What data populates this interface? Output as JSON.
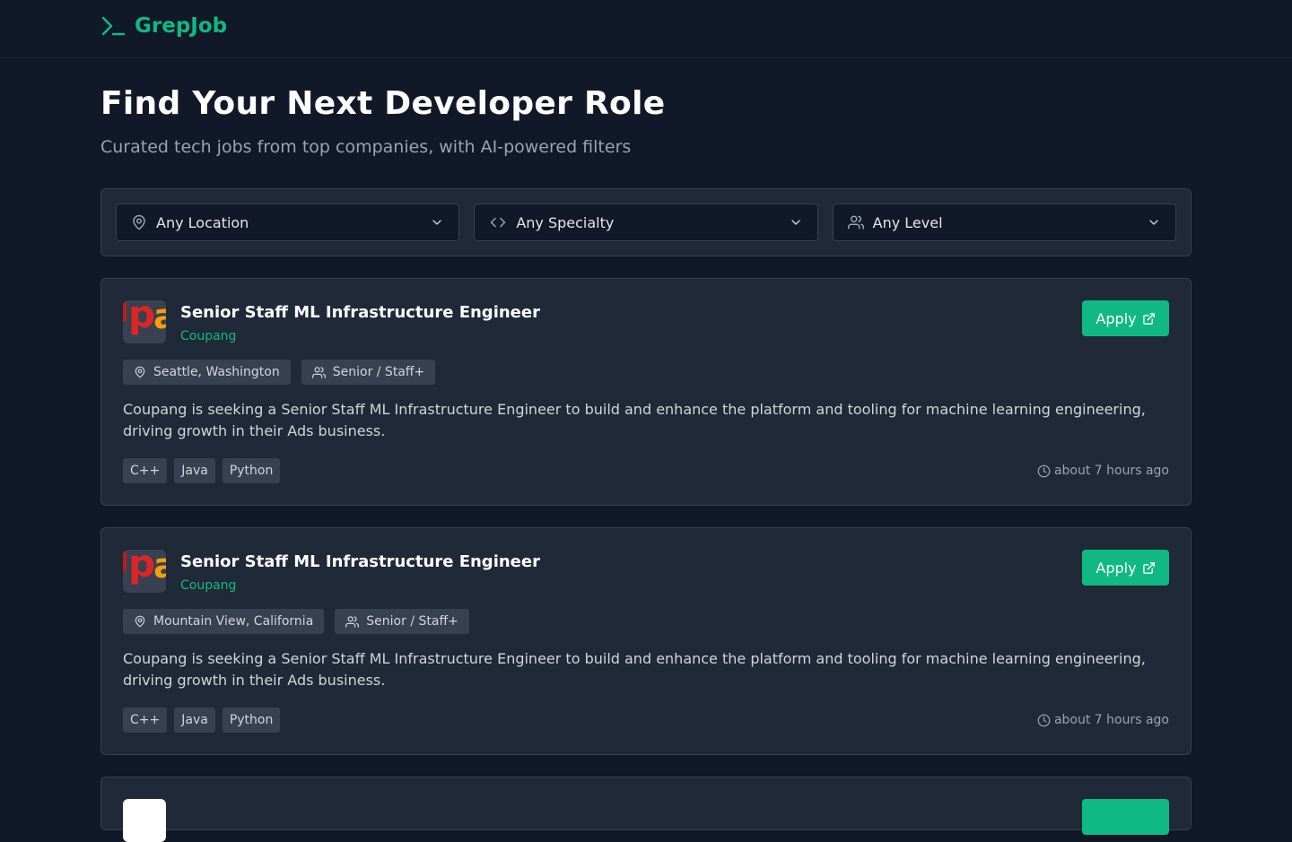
{
  "brand": {
    "name": "GrepJob",
    "accent": "#10b981"
  },
  "hero": {
    "title": "Find Your Next Developer Role",
    "subtitle": "Curated tech jobs from top companies, with AI-powered filters"
  },
  "filters": {
    "location": "Any Location",
    "specialty": "Any Specialty",
    "level": "Any Level"
  },
  "jobs": [
    {
      "title": "Senior Staff ML Infrastructure Engineer",
      "company": "Coupang",
      "location": "Seattle, Washington",
      "level": "Senior / Staff+",
      "description": "Coupang is seeking a Senior Staff ML Infrastructure Engineer to build and enhance the platform and tooling for machine learning engineering, driving growth in their Ads business.",
      "tags": [
        "C++",
        "Java",
        "Python"
      ],
      "posted": "about 7 hours ago",
      "apply_label": "Apply"
    },
    {
      "title": "Senior Staff ML Infrastructure Engineer",
      "company": "Coupang",
      "location": "Mountain View, California",
      "level": "Senior / Staff+",
      "description": "Coupang is seeking a Senior Staff ML Infrastructure Engineer to build and enhance the platform and tooling for machine learning engineering, driving growth in their Ads business.",
      "tags": [
        "C++",
        "Java",
        "Python"
      ],
      "posted": "about 7 hours ago",
      "apply_label": "Apply"
    }
  ],
  "icons": {
    "logo": "terminal-prompt-icon",
    "location": "map-pin-icon",
    "specialty": "code-brackets-icon",
    "level": "users-icon",
    "dropdown": "chevron-down-icon",
    "external": "external-link-icon",
    "posted": "clock-icon"
  }
}
